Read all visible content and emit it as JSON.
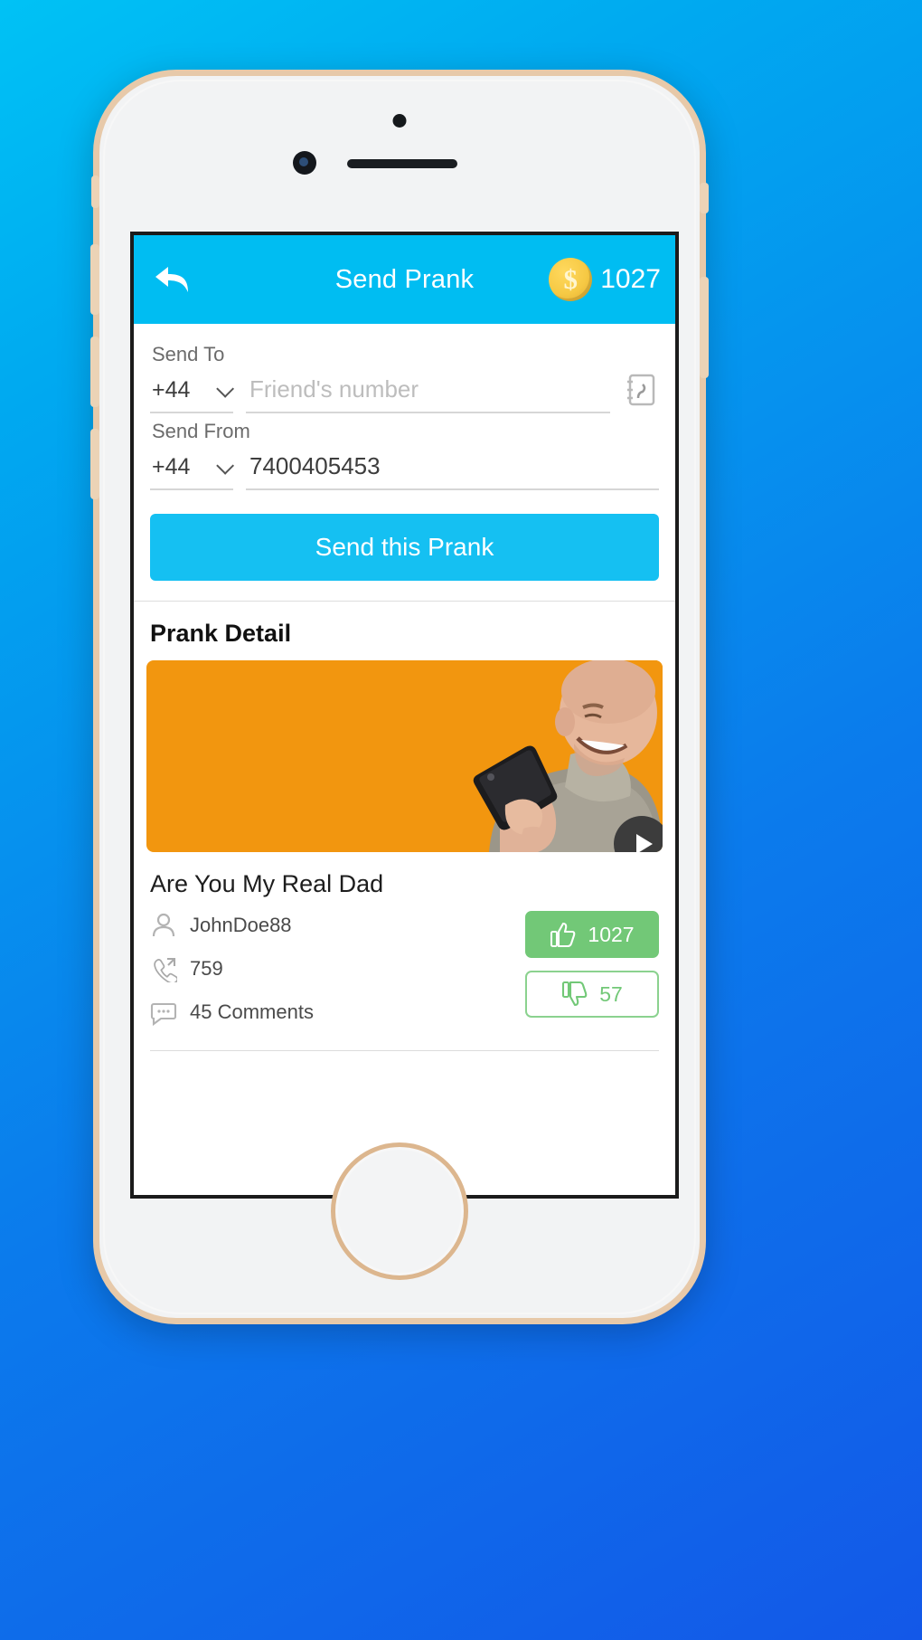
{
  "app": {
    "header": {
      "back_icon": "back-arrow-icon",
      "title": "Send Prank",
      "coin_icon": "dollar-coin-icon",
      "coin_count": "1027"
    },
    "form": {
      "send_to_label": "Send To",
      "send_to_country_code": "+44",
      "send_to_placeholder": "Friend's number",
      "send_to_value": "",
      "contacts_icon": "contact-book-icon",
      "send_from_label": "Send From",
      "send_from_country_code": "+44",
      "send_from_value": "7400405453",
      "submit_label": "Send this Prank"
    },
    "detail": {
      "section_heading": "Prank Detail",
      "play_icon": "play-icon",
      "thumbnail_bg_color": "#f2960f",
      "title": "Are You My Real Dad",
      "stats": [
        {
          "icon": "user-icon",
          "text": "JohnDoe88"
        },
        {
          "icon": "phone-call-icon",
          "text": "759"
        },
        {
          "icon": "comment-bubble-icon",
          "text": "45 Comments"
        }
      ],
      "votes": {
        "up_icon": "thumbs-up-icon",
        "up_count": "1027",
        "down_icon": "thumbs-down-icon",
        "down_count": "57"
      }
    }
  },
  "theme": {
    "accent_blue": "#00bdf2",
    "button_blue": "#15c0f2",
    "coin_gold": "#f6c944",
    "vote_green": "#72c877",
    "background_gradient_from": "#00c2f5",
    "background_gradient_to": "#1358e8"
  }
}
